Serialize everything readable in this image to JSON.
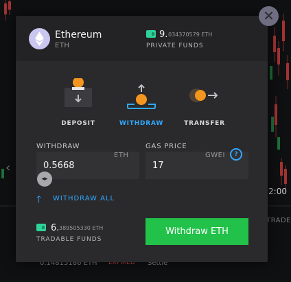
{
  "background": {
    "row_amount": "0.14815186 ETH",
    "row_status": "EXPIRED",
    "row_action": "Settle",
    "time_label": "2:00",
    "trade_label": "TRADE"
  },
  "modal": {
    "close_symbol": "✕",
    "coin": {
      "name": "Ethereum",
      "symbol": "ETH",
      "icon": "ethereum-icon"
    },
    "private_funds": {
      "icon": "wallet-icon",
      "whole": "9.",
      "fraction": "034370579 ETH",
      "label": "PRIVATE FUNDS"
    },
    "actions": [
      {
        "label": "DEPOSIT",
        "icon": "deposit-icon",
        "active": false
      },
      {
        "label": "WITHDRAW",
        "icon": "withdraw-icon",
        "active": true
      },
      {
        "label": "TRANSFER",
        "icon": "transfer-icon",
        "active": false
      }
    ],
    "withdraw_field": {
      "label": "WITHDRAW",
      "unit": "ETH",
      "value": "0.5668"
    },
    "gas_field": {
      "label": "GAS PRICE",
      "unit": "GWEI",
      "value": "17",
      "help": "?"
    },
    "slider_handle": "◂▸",
    "withdraw_all": {
      "arrow": "🡑",
      "label": "WITHDRAW ALL"
    },
    "tradable_funds": {
      "icon": "wallet-icon",
      "whole": "6.",
      "fraction": "389505330 ETH",
      "label": "TRADABLE FUNDS"
    },
    "submit_label": "Withdraw ETH"
  },
  "colors": {
    "accent_blue": "#31a8ff",
    "submit_green": "#22c14a",
    "wallet_green": "#2fd39a",
    "token_orange": "#f4961e",
    "close_purple": "#6f6d82"
  }
}
